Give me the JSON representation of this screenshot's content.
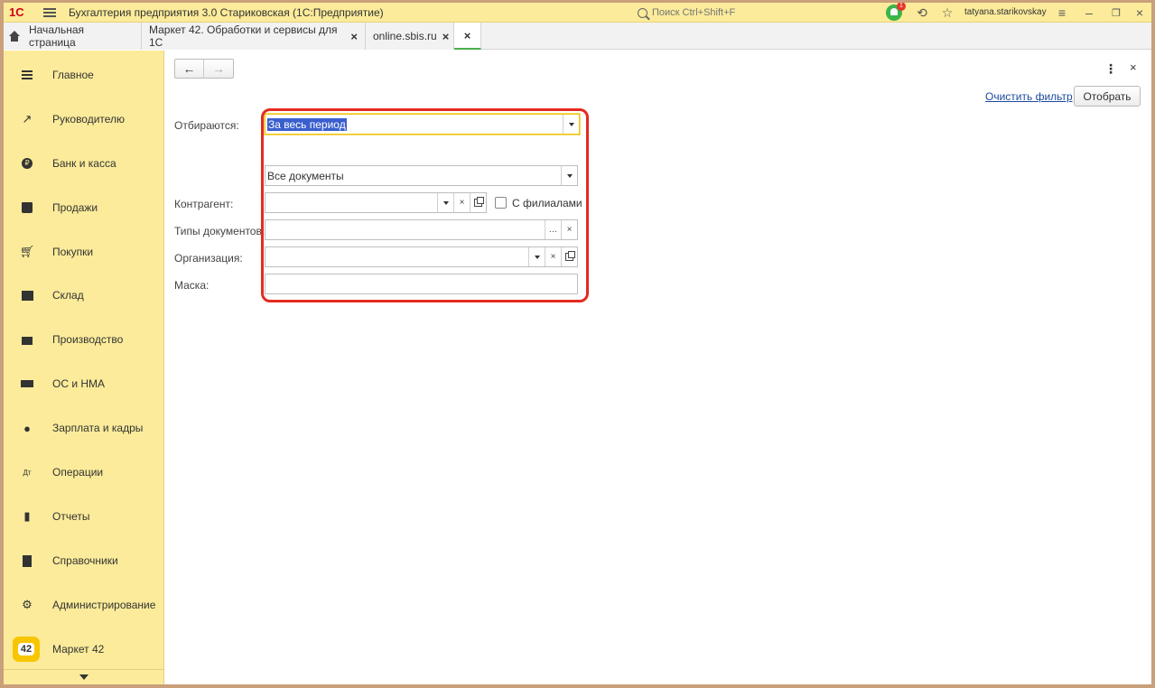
{
  "titlebar": {
    "logo": "1С",
    "title": "Бухгалтерия предприятия 3.0 Стариковская  (1С:Предприятие)",
    "search_placeholder": "Поиск Ctrl+Shift+F",
    "notifications_count": "1",
    "username": "tatyana.starikovskay"
  },
  "tabs": [
    {
      "label": "Начальная страница"
    },
    {
      "label": "Маркет 42. Обработки и сервисы для 1С"
    },
    {
      "label": "online.sbis.ru"
    },
    {
      "label": ""
    }
  ],
  "sidebar": {
    "items": [
      {
        "label": "Главное",
        "icon": "menu-icon"
      },
      {
        "label": "Руководителю",
        "icon": "trend-icon"
      },
      {
        "label": "Банк и касса",
        "icon": "ruble-icon"
      },
      {
        "label": "Продажи",
        "icon": "bag-icon"
      },
      {
        "label": "Покупки",
        "icon": "cart-icon"
      },
      {
        "label": "Склад",
        "icon": "warehouse-icon"
      },
      {
        "label": "Производство",
        "icon": "factory-icon"
      },
      {
        "label": "ОС и НМА",
        "icon": "truck-icon"
      },
      {
        "label": "Зарплата и кадры",
        "icon": "person-icon"
      },
      {
        "label": "Операции",
        "icon": "dt-kt-icon"
      },
      {
        "label": "Отчеты",
        "icon": "bar-chart-icon"
      },
      {
        "label": "Справочники",
        "icon": "book-icon"
      },
      {
        "label": "Администрирование",
        "icon": "gear-icon"
      },
      {
        "label": "Маркет 42",
        "icon": "market42-icon",
        "badge": "42"
      }
    ]
  },
  "toolbar": {
    "clear_filter": "Очистить фильтр",
    "select_button": "Отобрать",
    "more": "⋮",
    "close": "×"
  },
  "form": {
    "period_label": "Отбираются:",
    "period_value": "За весь период",
    "documents_value": "Все документы",
    "counterparty_label": "Контрагент:",
    "counterparty_value": "",
    "branches_label": "С филиалами",
    "doc_types_label": "Типы документов:",
    "doc_types_value": "",
    "organization_label": "Организация:",
    "organization_value": "",
    "mask_label": "Маска:",
    "mask_value": ""
  }
}
